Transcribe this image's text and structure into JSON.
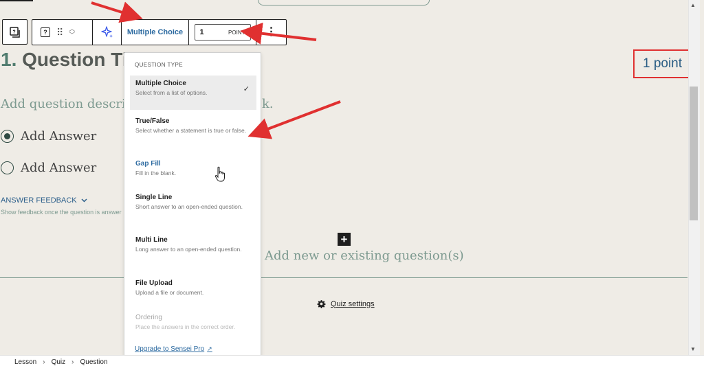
{
  "toolbar": {
    "question_type_label": "Multiple Choice",
    "points_value": "1",
    "points_unit": "POINT"
  },
  "question": {
    "number": "1.",
    "title_visible": "Question Ti",
    "points_display": "1 point",
    "description_placeholder": "Add question descriptio",
    "description_tail": "k.",
    "answers": [
      "Add Answer",
      "Add Answer"
    ],
    "feedback_title": "ANSWER FEEDBACK",
    "feedback_help": "Show feedback once the question is answer"
  },
  "add_new_label": "Add new or existing question(s)",
  "quiz_settings_label": "Quiz settings",
  "dropdown": {
    "heading": "QUESTION TYPE",
    "items": [
      {
        "title": "Multiple Choice",
        "desc": "Select from a list of options."
      },
      {
        "title": "True/False",
        "desc": "Select whether a statement is true or false."
      },
      {
        "title": "Gap Fill",
        "desc": "Fill in the blank."
      },
      {
        "title": "Single Line",
        "desc": "Short answer to an open-ended question."
      },
      {
        "title": "Multi Line",
        "desc": "Long answer to an open-ended question."
      },
      {
        "title": "File Upload",
        "desc": "Upload a file or document."
      },
      {
        "title": "Ordering",
        "desc": "Place the answers in the correct order."
      }
    ],
    "upgrade_label": "Upgrade to Sensei Pro"
  },
  "breadcrumb": [
    "Lesson",
    "Quiz",
    "Question"
  ],
  "colors": {
    "accent_blue": "#2c6aa0",
    "annotation_red": "#e03030",
    "muted_green": "#7d9a90",
    "canvas_bg": "#efece6"
  }
}
